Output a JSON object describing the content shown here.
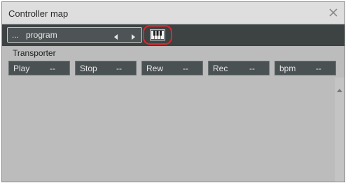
{
  "window": {
    "title": "Controller map"
  },
  "toolbar": {
    "program_prefix": "...",
    "program_name": "program"
  },
  "transporter": {
    "label": "Transporter",
    "buttons": [
      {
        "label": "Play",
        "value": "--"
      },
      {
        "label": "Stop",
        "value": "--"
      },
      {
        "label": "Rew",
        "value": "--"
      },
      {
        "label": "Rec",
        "value": "--"
      },
      {
        "label": "bpm",
        "value": "--"
      }
    ]
  },
  "icons": {
    "close": "close-icon",
    "prev": "chevron-left-icon",
    "next": "chevron-right-icon",
    "keyboard": "piano-keyboard-icon",
    "scroll_up": "scroll-up-arrow-icon",
    "scroll_down": "scroll-down-arrow-icon"
  },
  "colors": {
    "toolbar_bg": "#3d4243",
    "highlight": "#e0262b",
    "panel_bg": "#bcbcbc",
    "button_bg": "#4a5153"
  }
}
